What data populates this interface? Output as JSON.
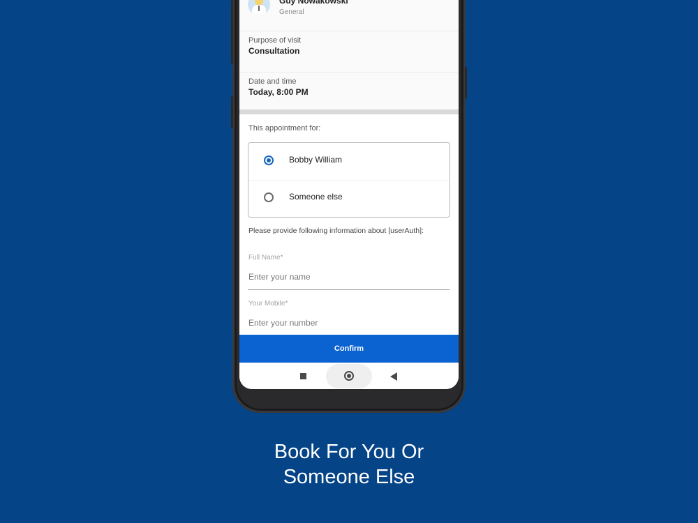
{
  "doctor": {
    "name": "Guy Nowakowski",
    "specialty": "General",
    "avatar_icon": "doctor-avatar-icon"
  },
  "visit": {
    "purpose_label": "Purpose of visit",
    "purpose_value": "Consultation",
    "datetime_label": "Date and time",
    "datetime_value": "Today, 8:00 PM"
  },
  "appointment_for": {
    "label": "This appointment for:",
    "options": [
      {
        "label": "Bobby William",
        "selected": true
      },
      {
        "label": "Someone else",
        "selected": false
      }
    ]
  },
  "form": {
    "instruction": "Please provide following information about [userAuth]:",
    "full_name_label": "Full Name*",
    "full_name_placeholder": "Enter your name",
    "mobile_label": "Your Mobile*",
    "mobile_placeholder": "Enter your number"
  },
  "confirm_label": "Confirm",
  "navbar": {
    "recents_icon": "square-icon",
    "home_icon": "circle-home-icon",
    "back_icon": "triangle-back-icon"
  },
  "caption": {
    "line1": "Book For You Or",
    "line2": "Someone Else"
  },
  "colors": {
    "background": "#054487",
    "accent": "#0a63d1",
    "radio_selected": "#1565c0"
  }
}
